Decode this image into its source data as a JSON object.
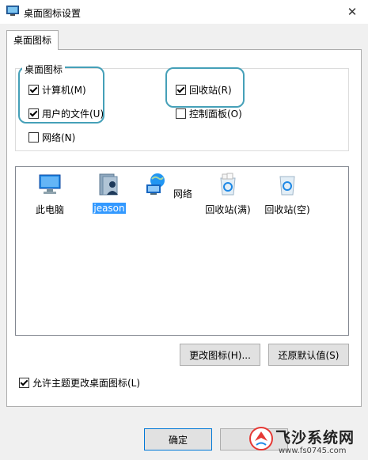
{
  "window": {
    "title": "桌面图标设置",
    "close_glyph": "✕"
  },
  "tabs": [
    {
      "label": "桌面图标"
    }
  ],
  "group": {
    "label": "桌面图标",
    "checkboxes": [
      {
        "label": "计算机(M)",
        "checked": true
      },
      {
        "label": "回收站(R)",
        "checked": true
      },
      {
        "label": "用户的文件(U)",
        "checked": true
      },
      {
        "label": "控制面板(O)",
        "checked": false
      },
      {
        "label": "网络(N)",
        "checked": false
      }
    ]
  },
  "icons": [
    {
      "label": "此电脑",
      "icon": "computer-icon",
      "selected": false
    },
    {
      "label": "jeason",
      "icon": "user-folder-icon",
      "selected": true
    },
    {
      "label": "网络",
      "icon": "network-icon",
      "selected": false
    },
    {
      "label": "回收站(满)",
      "icon": "recycle-bin-full-icon",
      "selected": false
    },
    {
      "label": "回收站(空)",
      "icon": "recycle-bin-empty-icon",
      "selected": false
    }
  ],
  "buttons": {
    "change_icon": "更改图标(H)...",
    "restore_default": "还原默认值(S)",
    "ok": "确定"
  },
  "allow_themes": {
    "label": "允许主题更改桌面图标(L)",
    "checked": true
  },
  "watermark": {
    "title": "飞沙系统网",
    "url": "www.fs0745.com"
  },
  "colors": {
    "highlight": "#45a0b8",
    "selection": "#3399ff",
    "ok_border": "#0078d7"
  }
}
